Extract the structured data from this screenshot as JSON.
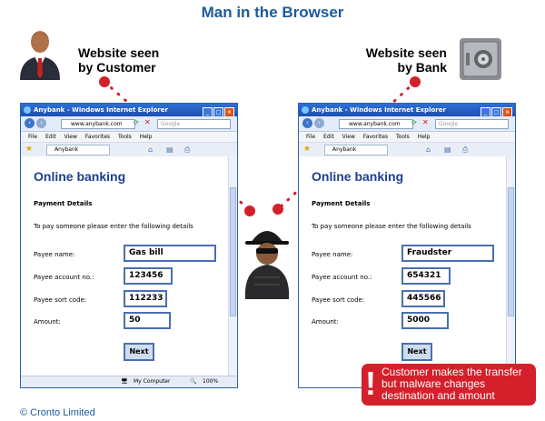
{
  "title": "Man in the Browser",
  "captions": {
    "customer": [
      "Website seen",
      "by Customer"
    ],
    "bank": [
      "Website seen",
      "by Bank"
    ]
  },
  "copyright": "© Cronto Limited",
  "alert": {
    "symbol": "!",
    "lines": [
      "Customer makes the transfer",
      "but malware changes",
      "destination and amount"
    ]
  },
  "browser_common": {
    "title": "Anybank - Windows Internet Explorer",
    "url": "www.anybank.com",
    "search_placeholder": "Google",
    "menu": [
      "File",
      "Edit",
      "View",
      "Favorites",
      "Tools",
      "Help"
    ],
    "tab": "Anybank",
    "heading": "Online banking",
    "section": "Payment Details",
    "instructions": "To pay someone please enter the following details",
    "labels": [
      "Payee name:",
      "Payee account no.:",
      "Payee sort code:",
      "Amount:"
    ],
    "next": "Next"
  },
  "customer_form": [
    "Gas bill",
    "123456",
    "112233",
    "50"
  ],
  "bank_form": [
    "Fraudster",
    "654321",
    "445566",
    "5000"
  ],
  "status": {
    "zone": "My Computer",
    "zoom": "100%"
  },
  "colors": {
    "title_blue": "#1c5a9c",
    "alert_red": "#d3202a",
    "dot_red": "#d3202a"
  }
}
